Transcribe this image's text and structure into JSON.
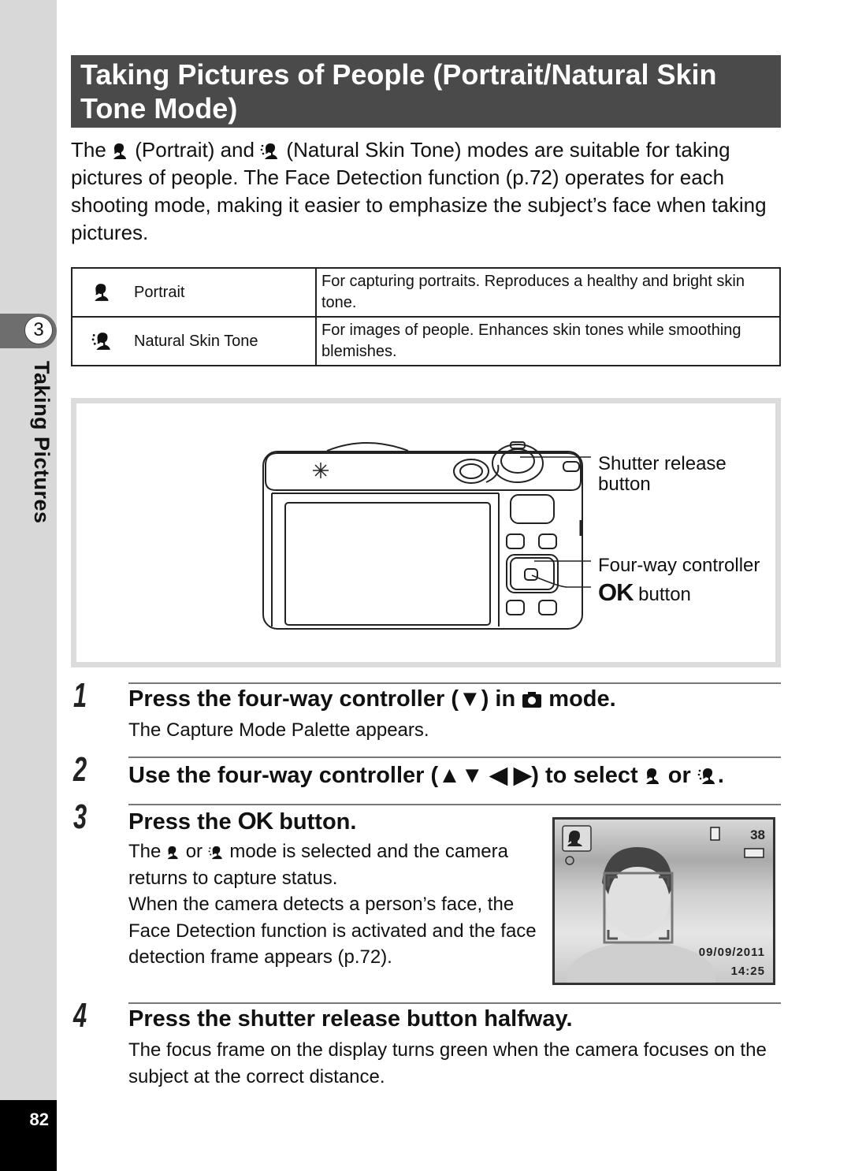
{
  "sidebar": {
    "chapter_number": "3",
    "chapter_title": "Taking Pictures",
    "page_number": "82"
  },
  "header": {
    "title": "Taking Pictures of People (Portrait/Natural Skin Tone Mode)"
  },
  "intro": {
    "part1": "The ",
    "part2": " (Portrait) and ",
    "part3": " (Natural Skin Tone) modes are suitable for taking pictures of people. The Face Detection function (p.72) operates for each shooting mode, making it easier to emphasize the subject’s face when taking pictures."
  },
  "modes": [
    {
      "icon": "portrait-icon",
      "name": "Portrait",
      "description": "For capturing portraits. Reproduces a healthy and bright skin tone."
    },
    {
      "icon": "natural-skin-tone-icon",
      "name": "Natural Skin Tone",
      "description": "For images of people. Enhances skin tones while smoothing blemishes."
    }
  ],
  "figure": {
    "callouts": {
      "shutter": "Shutter release\nbutton",
      "four_way": "Four-way controller",
      "ok_prefix": "OK",
      "ok_suffix": " button"
    }
  },
  "steps": [
    {
      "number": "1",
      "head_a": "Press the four-way controller (▼) in ",
      "head_b": " mode.",
      "body": "The Capture Mode Palette appears."
    },
    {
      "number": "2",
      "head_a": "Use the four-way controller (▲▼ ◀ ▶) to select ",
      "head_b": " or ",
      "head_c": "."
    },
    {
      "number": "3",
      "head_a": "Press the ",
      "head_ok": "OK",
      "head_b": " button.",
      "body_a": "The ",
      "body_b": " or ",
      "body_c": " mode is selected and the camera returns to capture status.",
      "body2": "When the camera detects a person’s face, the Face Detection function is activated and the face detection frame appears (p.72)."
    },
    {
      "number": "4",
      "head_a": "Press the shutter release button halfway.",
      "body": "The focus frame on the display turns green when the camera focuses on the subject at the correct distance."
    }
  ],
  "lcd": {
    "shots_remaining": "38",
    "date": "09/09/2011",
    "time": "14:25"
  }
}
